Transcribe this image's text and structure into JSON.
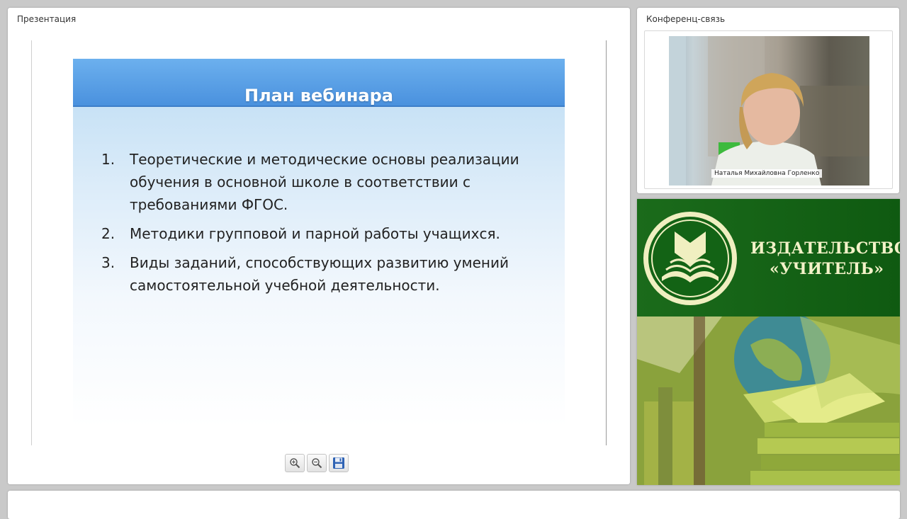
{
  "presentation": {
    "title": "Презентация",
    "slide": {
      "title": "План вебинара",
      "items": [
        {
          "number": "1.",
          "text": "Теоретические и методические основы реализации обучения в основной школе в соответствии с требованиями ФГОС."
        },
        {
          "number": "2.",
          "text": "Методики групповой и парной работы учащихся."
        },
        {
          "number": "3.",
          "text": "Виды заданий, способствующих развитию умений самостоятельной учебной деятельности."
        }
      ]
    },
    "toolbar": {
      "zoom_in_icon": "zoom-in-icon",
      "zoom_out_icon": "zoom-out-icon",
      "save_icon": "floppy-disk-icon"
    }
  },
  "conference": {
    "title": "Конференц-связь",
    "participant_name": "Наталья Михайловна Горленко"
  },
  "promo": {
    "publisher_line1": "ИЗДАТЕЛЬСТВО",
    "publisher_line2": "«УЧИТЕЛЬ»",
    "logo_icon": "open-book-logo-icon",
    "brand_green": "#0f5a11",
    "brand_cream": "#f3f2c8"
  },
  "colors": {
    "slide_header_blue": "#4a91de",
    "background": "#c9c9c9"
  }
}
